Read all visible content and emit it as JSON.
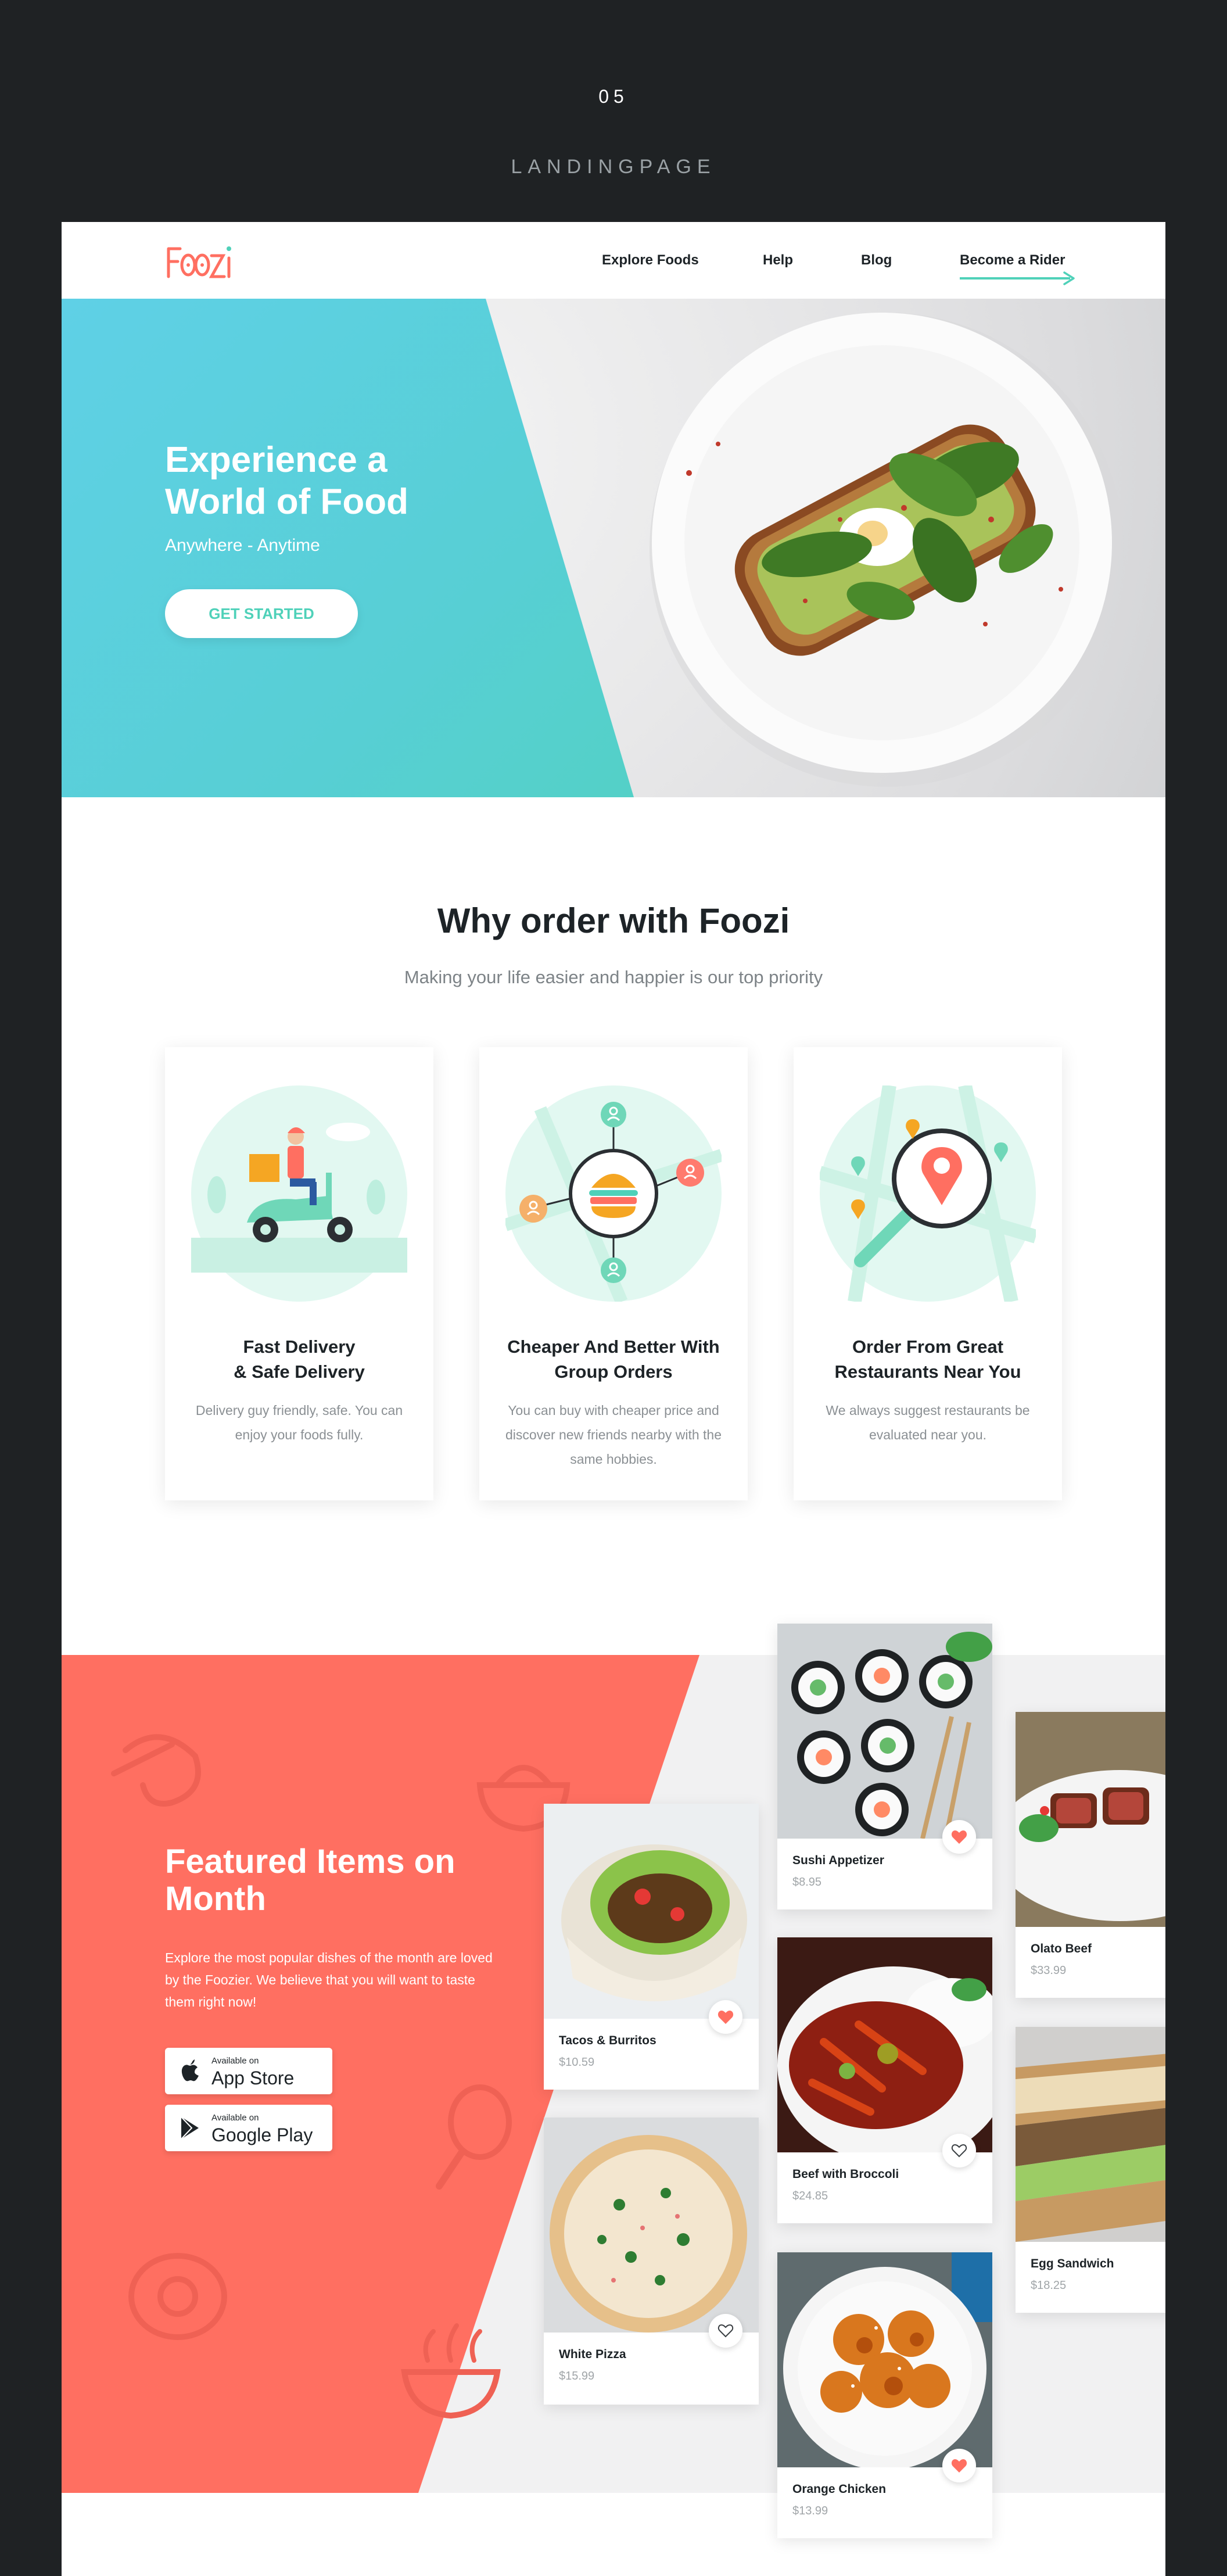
{
  "header": {
    "number": "05",
    "title": "LANDINGPAGE"
  },
  "nav": {
    "logo_text": "FOOZI",
    "links": [
      "Explore Foods",
      "Help",
      "Blog",
      "Become a Rider"
    ]
  },
  "hero": {
    "title": "Experience a World of Food",
    "subtitle": "Anywhere - Anytime",
    "cta": "GET STARTED"
  },
  "why": {
    "title": "Why order with Foozi",
    "subtitle": "Making your life easier and happier is our top priority",
    "cards": [
      {
        "title": "Fast Delivery\n& Safe Delivery",
        "desc": "Delivery guy friendly, safe. You can enjoy your foods fully.",
        "icon": "delivery-scooter-icon"
      },
      {
        "title": "Cheaper And Better  With\nGroup Orders",
        "desc": "You can buy with cheaper price and discover new friends nearby with the same hobbies.",
        "icon": "group-order-icon"
      },
      {
        "title": "Order From Great\nRestaurants Near You",
        "desc": "We always suggest restaurants be evaluated near you.",
        "icon": "map-search-icon"
      }
    ]
  },
  "featured": {
    "title": "Featured Items on Month",
    "desc": "Explore the most popular dishes of the month are loved by the Foozier. We believe that you will want to taste them right now!",
    "stores": [
      {
        "small": "Available on",
        "big": "App Store",
        "icon": "apple-icon"
      },
      {
        "small": "Available on",
        "big": "Google Play",
        "icon": "google-play-icon"
      }
    ],
    "items": [
      {
        "name": "Tacos & Burritos",
        "price": "$10.59",
        "favorited": true
      },
      {
        "name": "White Pizza",
        "price": "$15.99",
        "favorited": false
      },
      {
        "name": "Sushi Appetizer",
        "price": "$8.95",
        "favorited": true
      },
      {
        "name": "Beef with Broccoli",
        "price": "$24.85",
        "favorited": false
      },
      {
        "name": "Orange Chicken",
        "price": "$13.99",
        "favorited": true
      },
      {
        "name": "Olato Beef",
        "price": "$33.99",
        "favorited": false
      },
      {
        "name": "Egg Sandwich",
        "price": "$18.25",
        "favorited": false
      }
    ]
  },
  "colors": {
    "background": "#1f2224",
    "teal": "#4fd1b9",
    "cyan": "#5fd0e6",
    "coral": "#ff6f61",
    "heart": "#ff6f61",
    "text_dark": "#1d2327"
  }
}
